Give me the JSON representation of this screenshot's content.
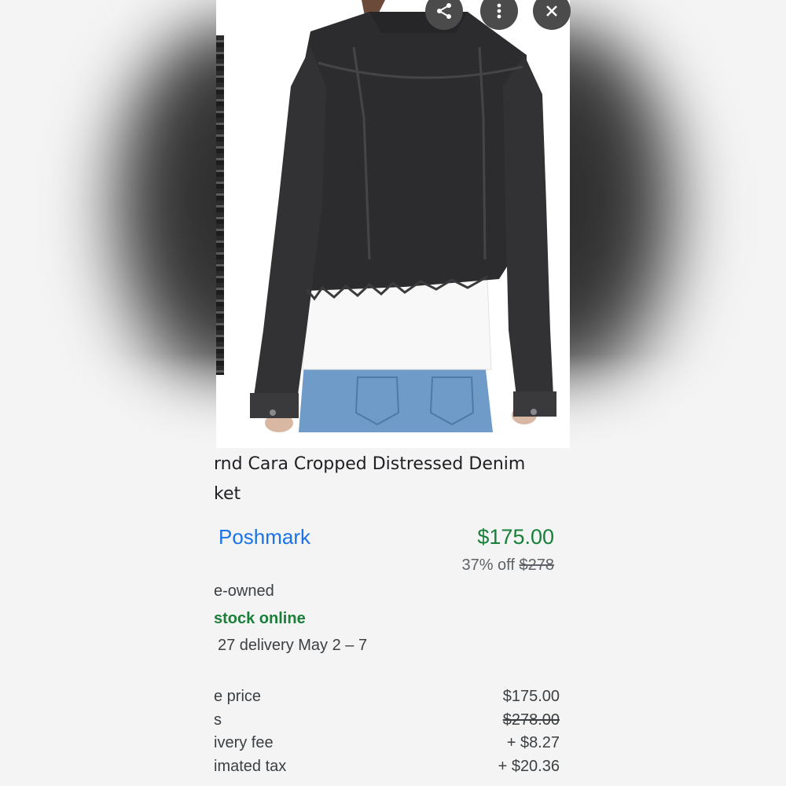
{
  "product": {
    "title_line1": "rnd Cara Cropped Distressed Denim",
    "title_line2": "ket"
  },
  "offer": {
    "seller": "Poshmark",
    "price": "$175.00",
    "discount_label": "37% off",
    "original_price": "$278",
    "condition": "e-owned",
    "stock": "stock online",
    "delivery": "27 delivery May 2 – 7"
  },
  "breakdown": [
    {
      "label": "e price",
      "value": "$175.00",
      "strike": false
    },
    {
      "label": "s",
      "value": "$278.00",
      "strike": true
    },
    {
      "label": "ivery fee",
      "value": "+ $8.27",
      "strike": false
    },
    {
      "label": "imated tax",
      "value": "+ $20.36",
      "strike": false
    }
  ],
  "icons": {
    "share": "share-icon",
    "more": "more-vert-icon",
    "close": "close-icon"
  },
  "colors": {
    "price_green": "#188038",
    "seller_blue": "#1a73e8",
    "fab_bg": "#4b4b4b"
  }
}
